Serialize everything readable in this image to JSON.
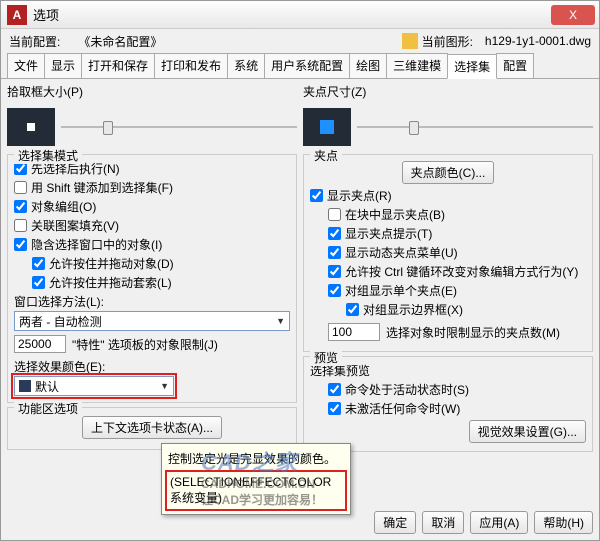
{
  "window": {
    "title": "选项",
    "close": "X",
    "app_icon_letter": "A"
  },
  "config": {
    "label_current_profile": "当前配置:",
    "current_profile": "《未命名配置》",
    "label_current_drawing": "当前图形:",
    "current_drawing": "h129-1y1-0001.dwg"
  },
  "tabs": [
    "文件",
    "显示",
    "打开和保存",
    "打印和发布",
    "系统",
    "用户系统配置",
    "绘图",
    "三维建模",
    "选择集",
    "配置"
  ],
  "active_tab": "选择集",
  "left": {
    "pickbox_title": "拾取框大小(P)",
    "mode_title": "选择集模式",
    "chk_pickfirst": "先选择后执行(N)",
    "chk_shift": "用 Shift 键添加到选择集(F)",
    "chk_group": "对象编组(O)",
    "chk_hatch": "关联图案填充(V)",
    "chk_window": "隐含选择窗口中的对象(I)",
    "chk_ldrag": "允许按住并拖动对象(D)",
    "chk_ldrag2": "允许按住并拖动套索(L)",
    "window_method_label": "窗口选择方法(L):",
    "window_method_value": "两者 - 自动检测",
    "prop_limit_value": "25000",
    "prop_limit_label": "\"特性\" 选项板的对象限制(J)",
    "effect_color_label": "选择效果颜色(E):",
    "effect_color_value": "默认",
    "ribbon_title": "功能区选项",
    "ribbon_btn": "上下文选项卡状态(A)..."
  },
  "right": {
    "gripsize_title": "夹点尺寸(Z)",
    "grip_title": "夹点",
    "grip_color_btn": "夹点颜色(C)...",
    "chk_show": "显示夹点(R)",
    "chk_inblock": "在块中显示夹点(B)",
    "chk_tips": "显示夹点提示(T)",
    "chk_dyn": "显示动态夹点菜单(U)",
    "chk_ctrl": "允许按 Ctrl 键循环改变对象编辑方式行为(Y)",
    "chk_groupgrip": "对组显示单个夹点(E)",
    "chk_groupbox": "对组显示边界框(X)",
    "grip_limit_value": "100",
    "grip_limit_label": "选择对象时限制显示的夹点数(M)",
    "preview_title": "预览",
    "preview_sub": "选择集预览",
    "chk_activecmd": "命令处于活动状态时(S)",
    "chk_nocmd": "未激活任何命令时(W)",
    "visual_btn": "视觉效果设置(G)..."
  },
  "tooltip": {
    "line1": "控制选定光是完显效果的颜色。",
    "line2": "(SELECTIONEFFECTCOLOR 系统变量)"
  },
  "buttons": {
    "ok": "确定",
    "cancel": "取消",
    "apply": "应用(A)",
    "help": "帮助(H)"
  },
  "watermark": {
    "main": "CAD之家",
    "sub1": "CADHOME.COM.CN",
    "sub2": "让CAD学习更加容易！"
  }
}
